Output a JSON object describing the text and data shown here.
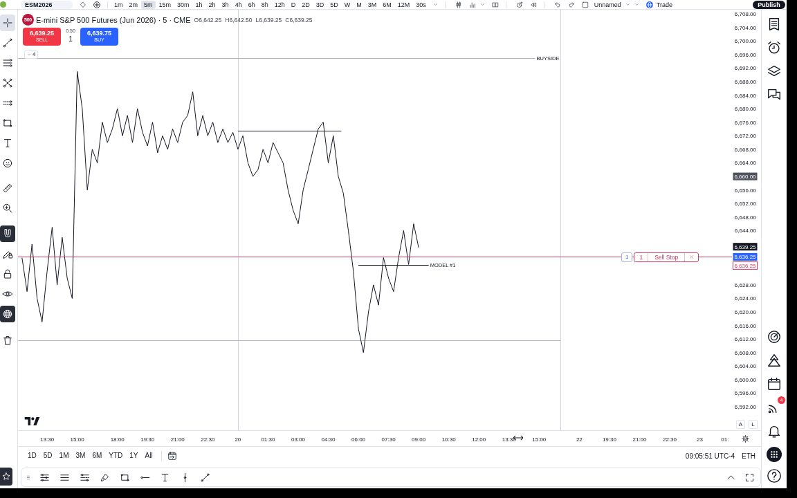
{
  "top_bar": {
    "symbol": "ESM2026",
    "intervals": [
      {
        "label": "1m",
        "selected": false
      },
      {
        "label": "2m",
        "selected": false
      },
      {
        "label": "5m",
        "selected": true
      },
      {
        "label": "15m",
        "selected": false
      },
      {
        "label": "30m",
        "selected": false
      },
      {
        "label": "1h",
        "selected": false
      },
      {
        "label": "2h",
        "selected": false
      },
      {
        "label": "3h",
        "selected": false
      },
      {
        "label": "4h",
        "selected": false
      },
      {
        "label": "6h",
        "selected": false
      },
      {
        "label": "8h",
        "selected": false
      },
      {
        "label": "12h",
        "selected": false
      },
      {
        "label": "D",
        "selected": false
      },
      {
        "label": "2D",
        "selected": false
      },
      {
        "label": "3D",
        "selected": false
      },
      {
        "label": "5D",
        "selected": false
      },
      {
        "label": "W",
        "selected": false
      },
      {
        "label": "M",
        "selected": false
      },
      {
        "label": "3M",
        "selected": false
      },
      {
        "label": "6M",
        "selected": false
      },
      {
        "label": "12M",
        "selected": false
      },
      {
        "label": "30s",
        "selected": false
      }
    ],
    "layout_name": "Unnamed",
    "trade": "Trade",
    "publish": "Publish"
  },
  "left_toolbar": {
    "tools": [
      {
        "selected": true
      },
      {
        "selected": false
      },
      {
        "selected": false
      },
      {
        "selected": false
      },
      {
        "selected": false
      },
      {
        "selected": false
      },
      {
        "selected": false
      },
      {
        "selected": false
      },
      {
        "selected": false
      },
      {
        "selected": false
      }
    ],
    "toggles": [
      {
        "on": true
      },
      {
        "on": false
      },
      {
        "on": false
      },
      {
        "on": false
      },
      {
        "on": true
      }
    ]
  },
  "chart": {
    "legend": {
      "logo": "500",
      "title": "E-mini S&P 500 Futures (Jun 2026) · 5 · CME",
      "ohlc": [
        "O6,642.25",
        "H6,642.50",
        "L6,639.25",
        "C6,639.25"
      ]
    },
    "trade_panel": {
      "sell_price": "6,639.25",
      "sell_label": "SELL",
      "spread": "0.50",
      "quantity": "1",
      "buy_price": "6,639.75",
      "buy_label": "BUY"
    },
    "indicator_count": "4",
    "scale_buttons": [
      "A",
      "L"
    ],
    "order": {
      "left_quantity": "1",
      "quantity": "1",
      "label": "Sell Stop"
    },
    "time_axis_cut_label": "01:",
    "chart_data": {
      "type": "line",
      "categories": [
        null,
        null,
        null,
        null,
        null,
        "13:30",
        null,
        null,
        null,
        null,
        null,
        "15:00",
        null,
        null,
        null,
        null,
        null,
        null,
        null,
        "18:00",
        null,
        null,
        null,
        null,
        null,
        "19:30",
        null,
        null,
        null,
        null,
        null,
        "21:00",
        null,
        null,
        null,
        null,
        null,
        "22:30",
        null,
        null,
        null,
        null,
        null,
        "20",
        null,
        null,
        null,
        null,
        null,
        "01:30",
        null,
        null,
        null,
        null,
        null,
        "03:00",
        null,
        null,
        null,
        null,
        null,
        "04:30",
        null,
        null,
        null,
        null,
        null,
        "06:00",
        null,
        null,
        null,
        null,
        null,
        "07:30",
        null,
        null,
        null,
        null,
        null,
        "09:00",
        null,
        null,
        null,
        null,
        null,
        "10:30",
        null,
        null,
        null,
        null,
        null,
        "12:00",
        null,
        null,
        null,
        null,
        null,
        "13:30",
        null,
        null,
        null,
        null,
        null,
        "15:00",
        null,
        null,
        null,
        null,
        null,
        null,
        null,
        "22",
        null,
        null,
        null,
        null,
        null,
        "19:30",
        null,
        null,
        null,
        null,
        null,
        "21:00",
        null,
        null,
        null,
        null,
        null,
        "22:30",
        null,
        null,
        null,
        null,
        null,
        "23",
        null,
        null,
        null,
        null
      ],
      "series": [
        {
          "color": "#131722",
          "values": [
            6636,
            6626,
            6640,
            6624,
            6617,
            6632,
            6645,
            6628,
            6642,
            6630,
            6624,
            6691,
            6680,
            6656,
            6668,
            6664,
            6676,
            6670,
            6674,
            6680,
            6672,
            6678,
            6670,
            6680,
            6673,
            6669,
            6676,
            6667,
            6672,
            6668,
            6674,
            6670,
            6676,
            6678,
            6685,
            6672,
            6678,
            6672,
            6676,
            6670,
            6674,
            6670,
            6673,
            6668,
            6672,
            6664,
            6660,
            6662,
            6668,
            6664,
            6670,
            6667,
            6664,
            6656,
            6650,
            6646,
            6656,
            6662,
            6668,
            6674,
            6676,
            6664,
            6672,
            6660,
            6655,
            6644,
            6632,
            6615,
            6608,
            6620,
            6628,
            6622,
            6636,
            6630,
            6626,
            6636,
            6644,
            6634,
            6646,
            6639,
            null,
            null,
            null,
            null,
            null,
            null,
            null,
            null,
            null,
            null,
            null,
            null,
            null,
            null,
            null,
            null,
            null,
            null,
            null,
            null,
            null,
            null,
            null,
            null,
            null,
            null,
            null,
            null,
            null,
            null,
            null,
            null,
            null,
            null,
            null,
            null,
            null,
            null,
            null,
            null,
            null,
            null,
            null,
            null,
            null,
            null,
            null,
            null,
            null,
            null,
            null,
            null,
            null,
            null,
            null,
            null,
            null,
            null,
            null,
            null
          ]
        }
      ],
      "ylim": [
        6585.07,
        6709.23
      ],
      "yticks": [
        {
          "value": 6708,
          "label": "6,708.00"
        },
        {
          "value": 6704,
          "label": "6,704.00"
        },
        {
          "value": 6700,
          "label": "6,700.00"
        },
        {
          "value": 6696,
          "label": "6,696.00"
        },
        {
          "value": 6692,
          "label": "6,692.00"
        },
        {
          "value": 6688,
          "label": "6,688.00"
        },
        {
          "value": 6684,
          "label": "6,684.00"
        },
        {
          "value": 6680,
          "label": "6,680.00"
        },
        {
          "value": 6676,
          "label": "6,676.00"
        },
        {
          "value": 6672,
          "label": "6,672.00"
        },
        {
          "value": 6668,
          "label": "6,668.00"
        },
        {
          "value": 6664,
          "label": "6,664.00"
        },
        {
          "value": 6656,
          "label": "6,656.00"
        },
        {
          "value": 6652,
          "label": "6,652.00"
        },
        {
          "value": 6648,
          "label": "6,648.00"
        },
        {
          "value": 6644,
          "label": "6,644.00"
        },
        {
          "value": 6628,
          "label": "6,628.00"
        },
        {
          "value": 6624,
          "label": "6,624.00"
        },
        {
          "value": 6620,
          "label": "6,620.00"
        },
        {
          "value": 6616,
          "label": "6,616.00"
        },
        {
          "value": 6612,
          "label": "6,612.00"
        },
        {
          "value": 6608,
          "label": "6,608.00"
        },
        {
          "value": 6604,
          "label": "6,604.00"
        },
        {
          "value": 6600,
          "label": "6,600.00"
        },
        {
          "value": 6596,
          "label": "6,596.00"
        },
        {
          "value": 6592,
          "label": "6,592.00"
        }
      ],
      "ref_lines": [
        {
          "axis": "y",
          "value": 6694.9,
          "label": "BUYSIDE"
        },
        {
          "axis": "y",
          "value": 6611.6
        },
        {
          "axis": "y",
          "value": 6673.5,
          "color": "#131722"
        },
        {
          "axis": "y",
          "value": 6633.9,
          "color": "#131722",
          "label": "MODEL #1"
        },
        {
          "axis": "y",
          "value": 6636.25,
          "color": "#d3365c"
        }
      ],
      "annotations": [
        {
          "text": "6,660.00",
          "y": 6660
        },
        {
          "text": "6,639.25",
          "y": 6639.25
        },
        {
          "text": "6,636.25",
          "y": 6636.25
        },
        {
          "text": "6,636.25",
          "y": 6633.7
        }
      ]
    }
  },
  "range_bar": {
    "ranges": [
      "1D",
      "5D",
      "1M",
      "3M",
      "6M",
      "YTD",
      "1Y",
      "All"
    ],
    "clock": "09:05:51 UTC-4",
    "session": "ETH"
  },
  "right_sidebar": {
    "badge": "4"
  }
}
